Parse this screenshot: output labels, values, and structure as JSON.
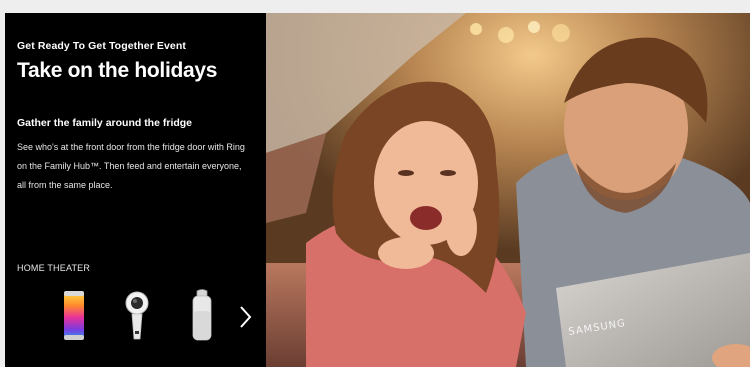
{
  "promo": {
    "eyebrow": "Get Ready To Get Together Event",
    "headline": "Take on the holidays",
    "subhead": "Gather the family around the fridge",
    "body": "See who's at the front door from the fridge door with Ring on the Family Hub™. Then feed and entertain everyone, all from the same place.",
    "category": "HOME THEATER",
    "products": [
      {
        "name": "speaker-pulse"
      },
      {
        "name": "360-camera"
      },
      {
        "name": "smart-speaker"
      }
    ],
    "next_icon": "chevron-right-icon"
  },
  "photo": {
    "brand_text": "SAMSUNG"
  }
}
